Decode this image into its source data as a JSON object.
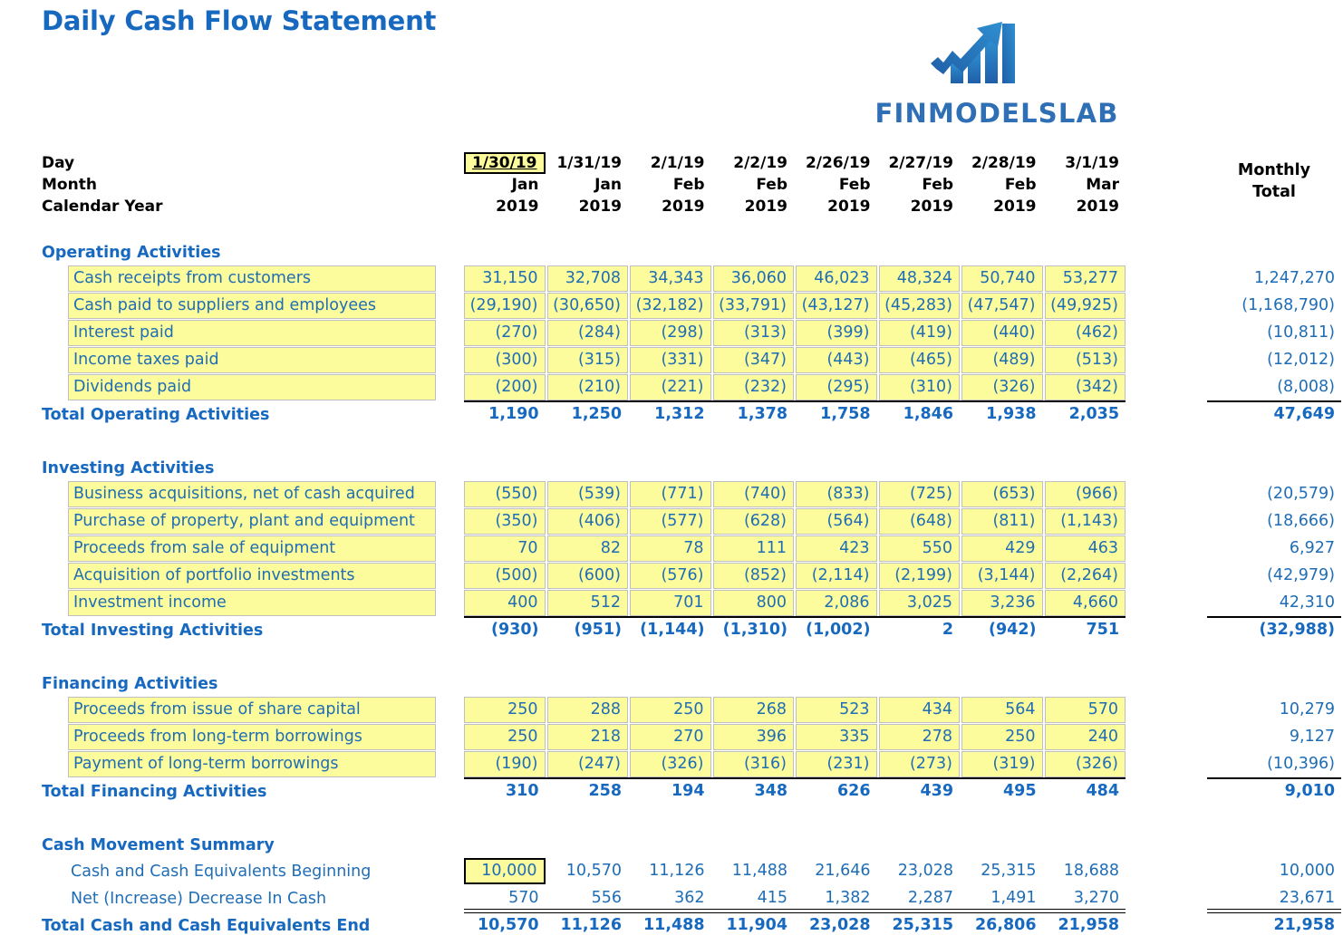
{
  "title": "Daily Cash Flow Statement",
  "logo": {
    "wordmark": "FINMODELSLAB",
    "icon": "bar-chart-arrow-icon",
    "color_dark": "#1f5fa8",
    "color_light": "#2f8fd0"
  },
  "theme": {
    "accent_blue": "#1769c0",
    "text_blue": "#1f6db5",
    "cell_yellow": "#fdfc9c",
    "cell_border": "#bfbfbf",
    "header_black": "#000000"
  },
  "header": {
    "row_labels": [
      "Day",
      "Month",
      "Calendar Year"
    ],
    "monthly_total_label_line1": "Monthly",
    "monthly_total_label_line2": "Total",
    "days": [
      "1/30/19",
      "1/31/19",
      "2/1/19",
      "2/2/19",
      "2/26/19",
      "2/27/19",
      "2/28/19",
      "3/1/19"
    ],
    "months": [
      "Jan",
      "Jan",
      "Feb",
      "Feb",
      "Feb",
      "Feb",
      "Feb",
      "Mar"
    ],
    "years": [
      "2019",
      "2019",
      "2019",
      "2019",
      "2019",
      "2019",
      "2019",
      "2019"
    ],
    "selected_day_index": 0
  },
  "sections": [
    {
      "name": "Operating Activities",
      "total_label": "Total Operating Activities",
      "rows": [
        {
          "label": "Cash receipts from customers",
          "values": [
            "31,150",
            "32,708",
            "34,343",
            "36,060",
            "46,023",
            "48,324",
            "50,740",
            "53,277"
          ],
          "monthly_total": "1,247,270"
        },
        {
          "label": "Cash paid to suppliers and employees",
          "values": [
            "(29,190)",
            "(30,650)",
            "(32,182)",
            "(33,791)",
            "(43,127)",
            "(45,283)",
            "(47,547)",
            "(49,925)"
          ],
          "monthly_total": "(1,168,790)"
        },
        {
          "label": "Interest paid",
          "values": [
            "(270)",
            "(284)",
            "(298)",
            "(313)",
            "(399)",
            "(419)",
            "(440)",
            "(462)"
          ],
          "monthly_total": "(10,811)"
        },
        {
          "label": "Income taxes paid",
          "values": [
            "(300)",
            "(315)",
            "(331)",
            "(347)",
            "(443)",
            "(465)",
            "(489)",
            "(513)"
          ],
          "monthly_total": "(12,012)"
        },
        {
          "label": "Dividends paid",
          "values": [
            "(200)",
            "(210)",
            "(221)",
            "(232)",
            "(295)",
            "(310)",
            "(326)",
            "(342)"
          ],
          "monthly_total": "(8,008)"
        }
      ],
      "totals": [
        "1,190",
        "1,250",
        "1,312",
        "1,378",
        "1,758",
        "1,846",
        "1,938",
        "2,035"
      ],
      "total_monthly": "47,649"
    },
    {
      "name": "Investing Activities",
      "total_label": "Total Investing Activities",
      "rows": [
        {
          "label": "Business acquisitions, net of cash acquired",
          "values": [
            "(550)",
            "(539)",
            "(771)",
            "(740)",
            "(833)",
            "(725)",
            "(653)",
            "(966)"
          ],
          "monthly_total": "(20,579)"
        },
        {
          "label": "Purchase of property, plant and equipment",
          "values": [
            "(350)",
            "(406)",
            "(577)",
            "(628)",
            "(564)",
            "(648)",
            "(811)",
            "(1,143)"
          ],
          "monthly_total": "(18,666)"
        },
        {
          "label": "Proceeds from sale of equipment",
          "values": [
            "70",
            "82",
            "78",
            "111",
            "423",
            "550",
            "429",
            "463"
          ],
          "monthly_total": "6,927"
        },
        {
          "label": "Acquisition of portfolio investments",
          "values": [
            "(500)",
            "(600)",
            "(576)",
            "(852)",
            "(2,114)",
            "(2,199)",
            "(3,144)",
            "(2,264)"
          ],
          "monthly_total": "(42,979)"
        },
        {
          "label": "Investment income",
          "values": [
            "400",
            "512",
            "701",
            "800",
            "2,086",
            "3,025",
            "3,236",
            "4,660"
          ],
          "monthly_total": "42,310"
        }
      ],
      "totals": [
        "(930)",
        "(951)",
        "(1,144)",
        "(1,310)",
        "(1,002)",
        "2",
        "(942)",
        "751"
      ],
      "total_monthly": "(32,988)"
    },
    {
      "name": "Financing Activities",
      "total_label": "Total Financing Activities",
      "rows": [
        {
          "label": "Proceeds from issue of share capital",
          "values": [
            "250",
            "288",
            "250",
            "268",
            "523",
            "434",
            "564",
            "570"
          ],
          "monthly_total": "10,279"
        },
        {
          "label": "Proceeds from long-term borrowings",
          "values": [
            "250",
            "218",
            "270",
            "396",
            "335",
            "278",
            "250",
            "240"
          ],
          "monthly_total": "9,127"
        },
        {
          "label": "Payment of long-term borrowings",
          "values": [
            "(190)",
            "(247)",
            "(326)",
            "(316)",
            "(231)",
            "(273)",
            "(319)",
            "(326)"
          ],
          "monthly_total": "(10,396)"
        }
      ],
      "totals": [
        "310",
        "258",
        "194",
        "348",
        "626",
        "439",
        "495",
        "484"
      ],
      "total_monthly": "9,010"
    }
  ],
  "summary": {
    "name": "Cash Movement Summary",
    "beginning": {
      "label": "Cash and Cash Equivalents Beginning",
      "values": [
        "10,000",
        "10,570",
        "11,126",
        "11,488",
        "21,646",
        "23,028",
        "25,315",
        "18,688"
      ],
      "monthly_total": "10,000",
      "selected_index": 0
    },
    "net_change": {
      "label": "Net (Increase) Decrease In Cash",
      "values": [
        "570",
        "556",
        "362",
        "415",
        "1,382",
        "2,287",
        "1,491",
        "3,270"
      ],
      "monthly_total": "23,671"
    },
    "ending": {
      "label": "Total Cash and Cash Equivalents End",
      "values": [
        "10,570",
        "11,126",
        "11,488",
        "11,904",
        "23,028",
        "25,315",
        "26,806",
        "21,958"
      ],
      "monthly_total": "21,958"
    }
  }
}
